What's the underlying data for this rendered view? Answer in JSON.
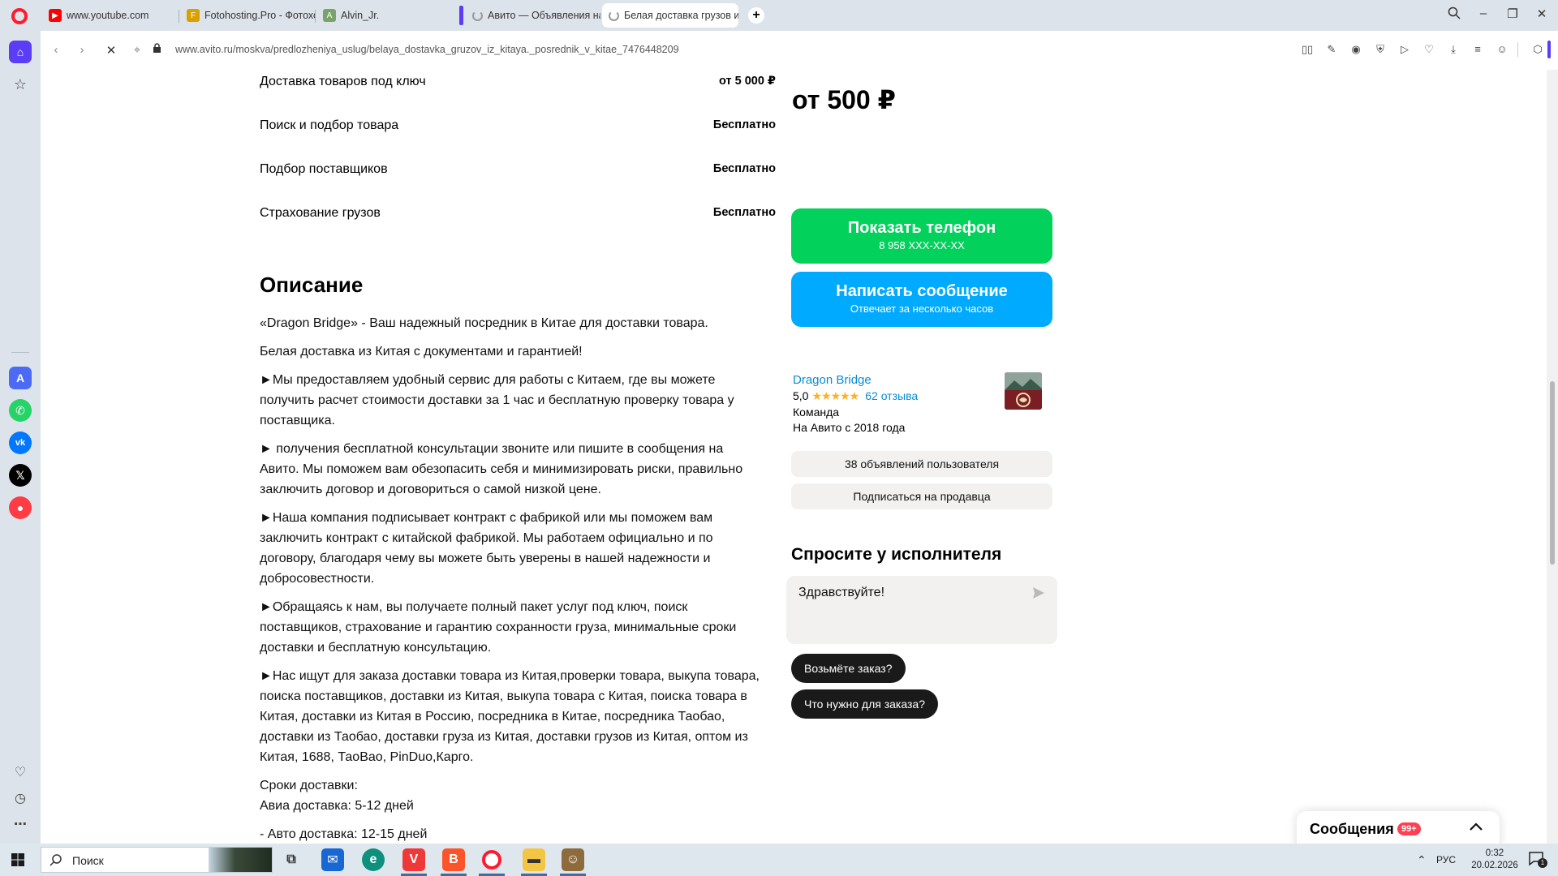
{
  "tabs": [
    {
      "title": "www.youtube.com",
      "icon": "youtube-icon"
    },
    {
      "title": "Fotohosting.Pro - Фотохо",
      "icon": "fotohosting-icon"
    },
    {
      "title": "Alvin_Jr.",
      "icon": "alvin-icon"
    },
    {
      "title": "Авито — Объявления на",
      "icon": "loading-icon"
    },
    {
      "title": "Белая доставка грузов из",
      "icon": "loading-icon"
    }
  ],
  "address_bar": {
    "url": "www.avito.ru/moskva/predlozheniya_uslug/belaya_dostavka_gruzov_iz_kitaya._posrednik_v_kitae_7476448209"
  },
  "services": [
    {
      "name": "Доставка товаров под ключ",
      "price": "от 5 000 ₽"
    },
    {
      "name": "Поиск и подбор товара",
      "price": "Бесплатно"
    },
    {
      "name": "Подбор поставщиков",
      "price": "Бесплатно"
    },
    {
      "name": "Страхование грузов",
      "price": "Бесплатно"
    }
  ],
  "description": {
    "title": "Описание",
    "paragraphs": [
      "«Dragon Bridge» - Ваш надежный посредник в Китае для доставки товара.",
      "Белая доставка из Китая с документами и гарантией!",
      "►Мы предоставляем удобный сервис для работы с Китаем, где вы можете получить расчет стоимости доставки за 1 час и бесплатную проверку товара у поставщика.",
      "► получения бесплатной консультации звоните или пишите в сообщения на Авито. Мы поможем вам обезопасить себя и минимизировать риски, правильно заключить договор и договориться о самой низкой цене.",
      "►Наша компания подписывает контракт с фабрикой или мы поможем вам заключить контракт с китайской фабрикой. Мы работаем официально и по договору, благодаря чему вы можете быть уверены в нашей надежности и добросовестности.",
      "►Обращаясь к нам, вы получаете полный пакет услуг под ключ, поиск поставщиков, страхование и гарантию сохранности груза, минимальные сроки доставки и бесплатную консультацию.",
      "►Нас ищут для заказа доставки товара из Китая,проверки товара, выкупа товара, поиска поставщиков, доставки из Китая, выкупа товара с Китая, поиска товара в Китая, доставки из Китая в Россию, посредника в Китае, посредника Таобао, доставки из Таобао, доставки груза из Китая, доставки грузов из Китая, оптом из Китая, 1688, ТаоВао, PinDuo,Карго."
    ],
    "terms_title": "Сроки доставки:",
    "terms_air": "Авиа доставка: 5-12 дней",
    "terms_auto": "- Авто доставка: 12-15 дней"
  },
  "price": "от 500 ₽",
  "show_phone": {
    "label": "Показать телефон",
    "sub": "8 958 XXX-XX-XX",
    "color": "#02d15c"
  },
  "write_message": {
    "label": "Написать сообщение",
    "sub": "Отвечает за несколько часов",
    "color": "#00aaff"
  },
  "seller": {
    "name": "Dragon Bridge",
    "rating": "5,0",
    "stars": 5,
    "reviews": "62 отзыва",
    "type": "Команда",
    "since": "На Авито с 2018 года"
  },
  "seller_ads_button": "38 объявлений пользователя",
  "subscribe_button": "Подписаться на продавца",
  "ask": {
    "title": "Спросите у исполнителя",
    "message": "Здравствуйте!",
    "chips": [
      "Возьмёте заказ?",
      "Что нужно для заказа?"
    ]
  },
  "messages_widget": {
    "label": "Сообщения",
    "badge": "99+"
  },
  "taskbar": {
    "search_placeholder": "Поиск",
    "language": "РУС",
    "time": "0:32",
    "date": "20.02.2026",
    "notifications": "1"
  },
  "colors": {
    "avito_link": "#0a8bd1",
    "star": "#ffb021",
    "badge": "#ff4053"
  }
}
